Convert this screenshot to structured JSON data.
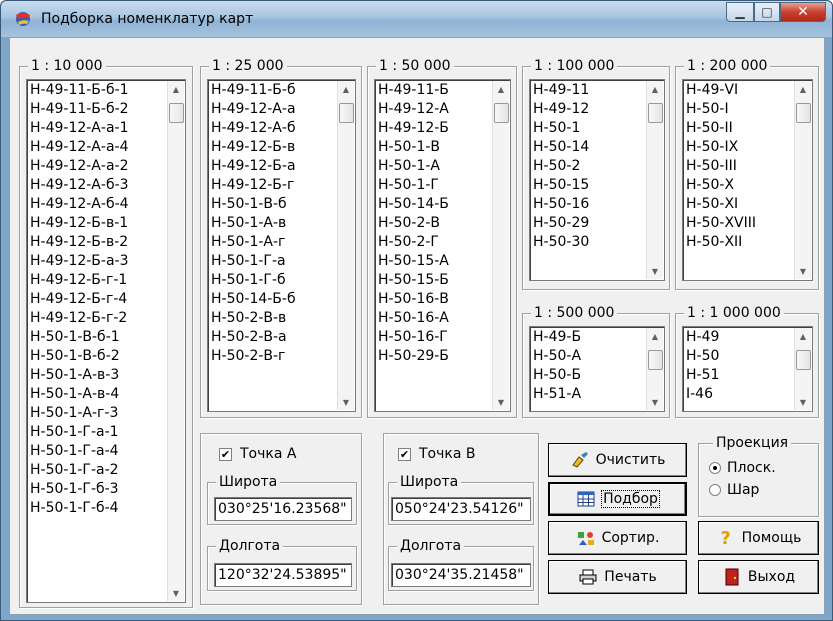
{
  "window": {
    "title": "Подборка номенклатур карт"
  },
  "groups": {
    "g10000": {
      "label": "1 : 10 000",
      "items": [
        "Н-49-11-Б-б-1",
        "Н-49-11-Б-б-2",
        "Н-49-12-А-а-1",
        "Н-49-12-А-а-4",
        "Н-49-12-А-а-2",
        "Н-49-12-А-б-3",
        "Н-49-12-А-б-4",
        "Н-49-12-Б-в-1",
        "Н-49-12-Б-в-2",
        "Н-49-12-Б-а-3",
        "Н-49-12-Б-г-1",
        "Н-49-12-Б-г-4",
        "Н-49-12-Б-г-2",
        "Н-50-1-В-б-1",
        "Н-50-1-В-б-2",
        "Н-50-1-А-в-3",
        "Н-50-1-А-в-4",
        "Н-50-1-А-г-3",
        "Н-50-1-Г-а-1",
        "Н-50-1-Г-а-4",
        "Н-50-1-Г-а-2",
        "Н-50-1-Г-б-3",
        "Н-50-1-Г-б-4"
      ]
    },
    "g25000": {
      "label": "1 : 25 000",
      "items": [
        "Н-49-11-Б-б",
        "Н-49-12-А-а",
        "Н-49-12-А-б",
        "Н-49-12-Б-в",
        "Н-49-12-Б-а",
        "Н-49-12-Б-г",
        "Н-50-1-В-б",
        "Н-50-1-А-в",
        "Н-50-1-А-г",
        "Н-50-1-Г-а",
        "Н-50-1-Г-б",
        "Н-50-14-Б-б",
        "Н-50-2-В-в",
        "Н-50-2-В-а",
        "Н-50-2-В-г"
      ]
    },
    "g50000": {
      "label": "1 : 50 000",
      "items": [
        "Н-49-11-Б",
        "Н-49-12-А",
        "Н-49-12-Б",
        "Н-50-1-В",
        "Н-50-1-А",
        "Н-50-1-Г",
        "Н-50-14-Б",
        "Н-50-2-В",
        "Н-50-2-Г",
        "Н-50-15-А",
        "Н-50-15-Б",
        "Н-50-16-В",
        "Н-50-16-А",
        "Н-50-16-Г",
        "Н-50-29-Б"
      ]
    },
    "g100000": {
      "label": "1 : 100 000",
      "items": [
        "Н-49-11",
        "Н-49-12",
        "Н-50-1",
        "Н-50-14",
        "Н-50-2",
        "Н-50-15",
        "Н-50-16",
        "Н-50-29",
        "Н-50-30"
      ]
    },
    "g200000": {
      "label": "1 : 200 000",
      "items": [
        "Н-49-VI",
        "Н-50-I",
        "Н-50-II",
        "Н-50-IX",
        "Н-50-III",
        "Н-50-X",
        "Н-50-XI",
        "Н-50-XVIII",
        "Н-50-XII"
      ]
    },
    "g500000": {
      "label": "1 : 500 000",
      "items": [
        "Н-49-Б",
        "Н-50-А",
        "Н-50-Б",
        "Н-51-А"
      ]
    },
    "g1000000": {
      "label": "1 : 1 000 000",
      "items": [
        "Н-49",
        "Н-50",
        "Н-51",
        "І-46"
      ]
    }
  },
  "pointA": {
    "check_label": "Точка А",
    "checked": "✔",
    "lat_label": "Широта",
    "lat_value": "030°25'16.23568\"",
    "lon_label": "Долгота",
    "lon_value": "120°32'24.53895\""
  },
  "pointB": {
    "check_label": "Точка В",
    "checked": "✔",
    "lat_label": "Широта",
    "lat_value": "050°24'23.54126\"",
    "lon_label": "Долгота",
    "lon_value": "030°24'35.21458\""
  },
  "buttons": {
    "clear": "Очистить",
    "select": "Подбор",
    "sort": "Сортир.",
    "print": "Печать",
    "help": "Помощь",
    "exit": "Выход"
  },
  "projection": {
    "label": "Проекция",
    "flat": "Плоск.",
    "sphere": "Шар"
  }
}
